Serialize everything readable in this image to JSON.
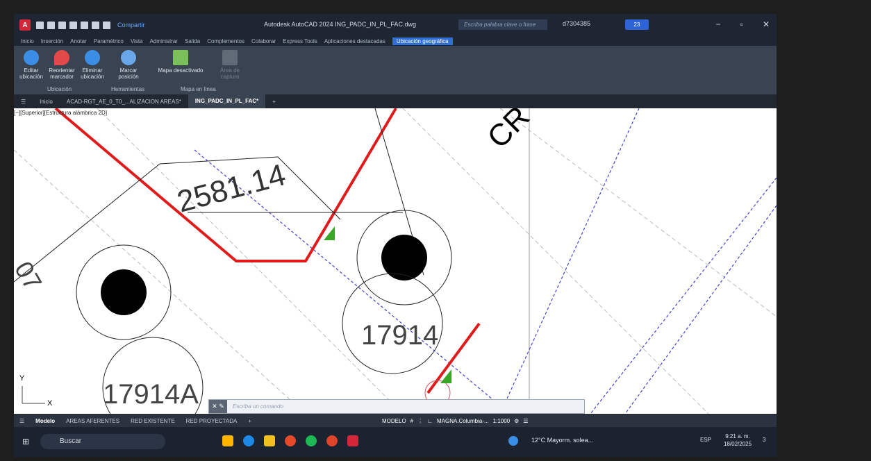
{
  "titlebar": {
    "share_label": "Compartir",
    "window_title": "Autodesk AutoCAD 2024   ING_PADC_IN_PL_FAC.dwg",
    "search_placeholder": "Escriba palabra clave o frase",
    "user": "d7304385",
    "clock_badge": "23"
  },
  "menu": [
    "Inicio",
    "Inserción",
    "Anotar",
    "Paramétrico",
    "Vista",
    "Administrar",
    "Salida",
    "Complementos",
    "Colaborar",
    "Express Tools",
    "Aplicaciones destacadas",
    "Ubicación geográfica"
  ],
  "ribbon": {
    "buttons": [
      "Editar ubicación",
      "Reorientar marcador",
      "Eliminar ubicación",
      "Marcar posición",
      "Mapa desactivado",
      "Área de captura"
    ],
    "groups": [
      "Ubicación",
      "Herramientas",
      "Mapa en línea"
    ]
  },
  "doctabs": [
    "Inicio",
    "ACAD-RGT_AE_0_T0_...ALIZACION AREAS*",
    "ING_PADC_IN_PL_FAC*"
  ],
  "viewport_label": "[−][Superior][Estructura alámbrica 2D]",
  "drawing": {
    "dim_text": "2581.14",
    "lot_label_1": "17914",
    "lot_label_2": "17914A",
    "road_label": "CR",
    "small_label": "07",
    "axis_y": "Y",
    "axis_x": "X"
  },
  "command": {
    "placeholder": "Escriba un comando"
  },
  "layout_tabs": [
    "Modelo",
    "AREAS AFERENTES",
    "RED EXISTENTE",
    "RED PROYECTADA"
  ],
  "status": {
    "model": "MODELO",
    "coord_system": "MAGNA.Columbia-...",
    "scale": "1:1000"
  },
  "taskbar": {
    "search": "Buscar",
    "weather": "12°C  Mayorm. solea...",
    "lang": "ESP",
    "time": "9:21 a. m.",
    "date": "18/02/2025",
    "notif": "3"
  },
  "colors": {
    "accent": "#2f6fd6",
    "road": "#e01b1b",
    "logo": "#d4263a"
  }
}
